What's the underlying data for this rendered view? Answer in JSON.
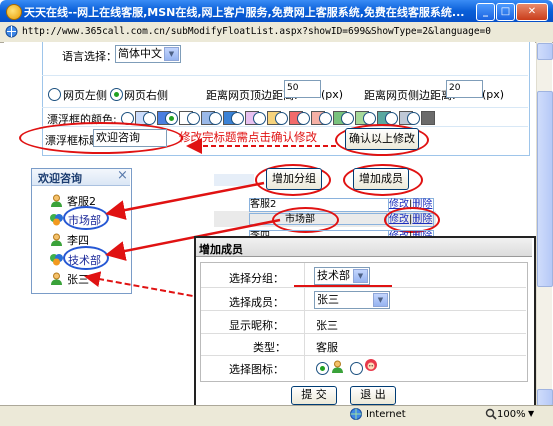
{
  "window": {
    "title": "天天在线--网上在线客服,MSN在线,网上客户服务,免费网上客服系统,免费在线客服系统...",
    "address": "http://www.365call.com.cn/subModifyFloatList.aspx?showID=699&ShowType=2&language=0"
  },
  "form": {
    "language_label": "语言选择：",
    "language_value": "简体中文",
    "position_left": "网页左侧",
    "position_right": "网页右侧",
    "top_distance_label": "距离网页顶边距离:",
    "top_distance_value": "50",
    "side_distance_label": "距离网页侧边距离:",
    "side_distance_value": "20",
    "unit": "(px)",
    "color_label": "漂浮框的颜色:",
    "title_label": "漂浮框标题:",
    "title_value": "欢迎咨询",
    "annotation": "修改完标题需点击确认修改",
    "confirm_button": "确认以上修改",
    "colors": [
      "#cbdcfb",
      "#4a7ee0",
      "#ffffff",
      "#9ab8e8",
      "#3b82d6",
      "#e8c1f0",
      "#f6d37d",
      "#f26b6b",
      "#f6b0a5",
      "#78c27d",
      "#a7d99a",
      "#5aa8a0",
      "#bfc8d6",
      "#6b6b6b"
    ]
  },
  "float_panel": {
    "title": "欢迎咨询",
    "close": "×",
    "items": [
      {
        "label": "客服2",
        "icon": "user-icon"
      },
      {
        "label": "市场部",
        "icon": "msn-group-icon"
      },
      {
        "label": "李四",
        "icon": "user-icon"
      },
      {
        "label": "技术部",
        "icon": "msn-group-icon"
      },
      {
        "label": "张三",
        "icon": "user-icon"
      }
    ]
  },
  "toolbar": {
    "add_group": "增加分组",
    "add_member": "增加成员"
  },
  "list_table": {
    "rows": [
      {
        "name": "客服2",
        "edit": "修改",
        "sep": "|",
        "del": "删除"
      },
      {
        "name": "市场部",
        "edit": "修改",
        "sep": "|",
        "del": "删除"
      },
      {
        "name": "李四",
        "edit": "修改",
        "sep": "|",
        "del": "删除"
      }
    ]
  },
  "dialog": {
    "title": "增加成员",
    "group_label": "选择分组：",
    "group_value": "技术部",
    "member_label": "选择成员：",
    "member_value": "张三",
    "nickname_label": "显示昵称：",
    "nickname_value": "张三",
    "type_label": "类型：",
    "type_value": "客服",
    "icon_label": "选择图标：",
    "submit": "提 交",
    "exit": "退 出"
  },
  "status": {
    "zone": "Internet",
    "zoom": "100%"
  }
}
